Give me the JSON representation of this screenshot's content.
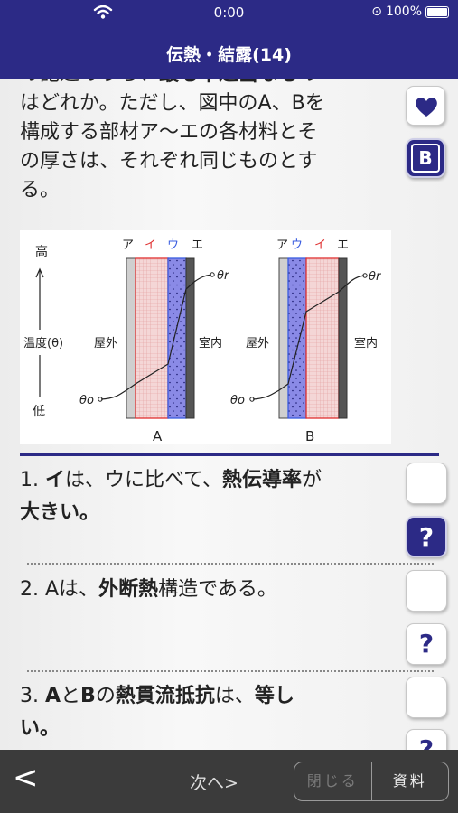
{
  "status": {
    "time": "0:00",
    "battery": "100%"
  },
  "nav": {
    "title": "伝熱・結露(14)"
  },
  "question": {
    "line1_pre": "の記述のうち、",
    "line1_bold": "最も不適当なも",
    "line1_post": "の",
    "line2": "はどれか。ただし、図中のA、Bを",
    "line3": "構成する部材ア～エの各材料とそ",
    "line4": "の厚さは、それぞれ同じものとす",
    "line5": "る。"
  },
  "side": {
    "favorite_icon": "heart-icon",
    "bookmark_label": "B"
  },
  "figure": {
    "axis_high": "高",
    "axis_label": "温度(θ)",
    "axis_low": "低",
    "outdoor": "屋外",
    "indoor": "室内",
    "theta_o": "θo",
    "theta_r": "θr",
    "a": {
      "label": "A",
      "layers": [
        "ア",
        "イ",
        "ウ",
        "エ"
      ]
    },
    "b": {
      "label": "B",
      "layers": [
        "ア",
        "ウ",
        "イ",
        "エ"
      ]
    },
    "colors": {
      "i_layer": "#e03030",
      "u_layer": "#3a5de0",
      "accent": "#2c2a86"
    }
  },
  "choices": [
    {
      "num": "1.",
      "t1": "イ",
      "t2": "は、ウに比べて、",
      "t3": "熱伝導率",
      "t4": "が",
      "t5": "大きい。",
      "help": "?"
    },
    {
      "num": "2.",
      "t1": "Aは、",
      "t2": "外断熱",
      "t3": "構造である。",
      "help": "?"
    },
    {
      "num": "3.",
      "t1": "A",
      "t2": "と",
      "t3": "B",
      "t4": "の",
      "t5": "熱貫流抵抗",
      "t6": "は、",
      "t7": "等し",
      "t8": "い。",
      "help": "?"
    }
  ],
  "toolbar": {
    "back": "<",
    "next": "次へ>",
    "close": "閉じる",
    "materials": "資料"
  }
}
